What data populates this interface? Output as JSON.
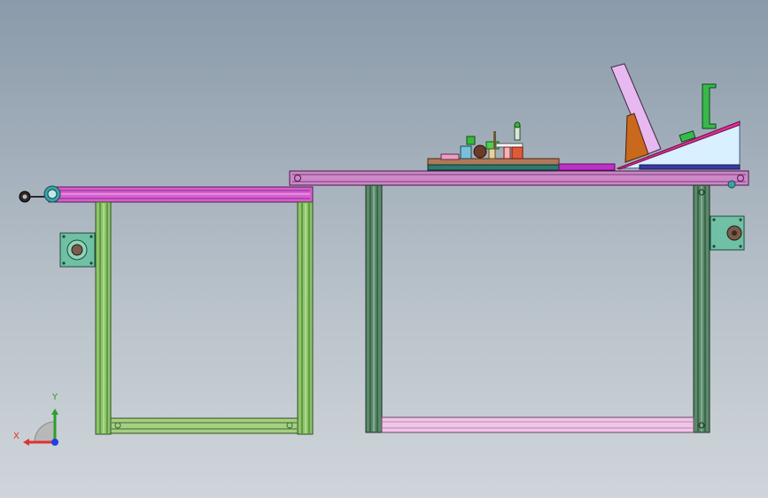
{
  "viewport": {
    "background_top": "#8a9aaa",
    "background_bottom": "#cfd5da"
  },
  "colors": {
    "left_frame": "#7fb85a",
    "left_frame_dark": "#3f6b2a",
    "right_frame": "#4a7a5a",
    "right_frame_dark": "#23422e",
    "top_beam": "#d65fcf",
    "top_beam_dark": "#6a1f66",
    "right_table_top": "#cc88c8",
    "bottom_rail_right": "#f2c4e8",
    "mount_plate": "#6fc0a4",
    "axis_x": "#e03030",
    "axis_y": "#2aa02a",
    "axis_z": "#2040e0"
  },
  "triad": {
    "x_label": "X",
    "y_label": "Y"
  },
  "icons": {
    "pulley": "pulley-icon",
    "motor_mount": "motor-mount-icon",
    "coordinate_triad": "coordinate-triad-icon"
  }
}
